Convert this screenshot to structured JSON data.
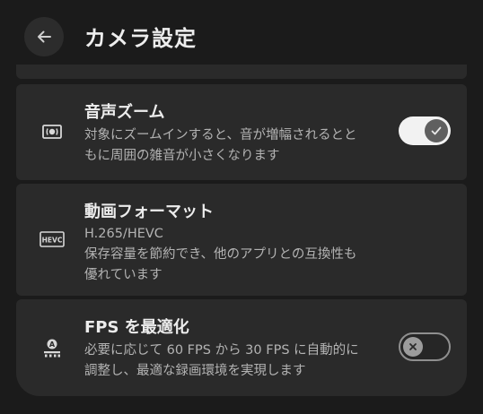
{
  "header": {
    "back_icon": "arrow-left-icon",
    "title": "カメラ設定"
  },
  "settings": [
    {
      "icon": "audio-zoom-icon",
      "title": "音声ズーム",
      "desc_line1": "対象にズームインすると、音が増幅されるとと",
      "desc_line2": "もに周囲の雑音が小さくなります",
      "toggle": "on"
    },
    {
      "icon": "hevc-icon",
      "icon_text": "HEVC",
      "title": "動画フォーマット",
      "value": "H.265/HEVC",
      "desc_line1": "保存容量を節約でき、他のアプリとの互換性も",
      "desc_line2": "優れています"
    },
    {
      "icon": "auto-fps-icon",
      "icon_text": "A",
      "title": "FPS を最適化",
      "desc_line1": "必要に応じて 60 FPS から 30 FPS に自動的に",
      "desc_line2": "調整し、最適な録画環境を実現します",
      "toggle": "off"
    }
  ],
  "colors": {
    "background": "#1b1b1b",
    "card": "#2a2a2a",
    "toggle_on_track": "#f2f2f2",
    "toggle_off_border": "#8f8f8f"
  }
}
